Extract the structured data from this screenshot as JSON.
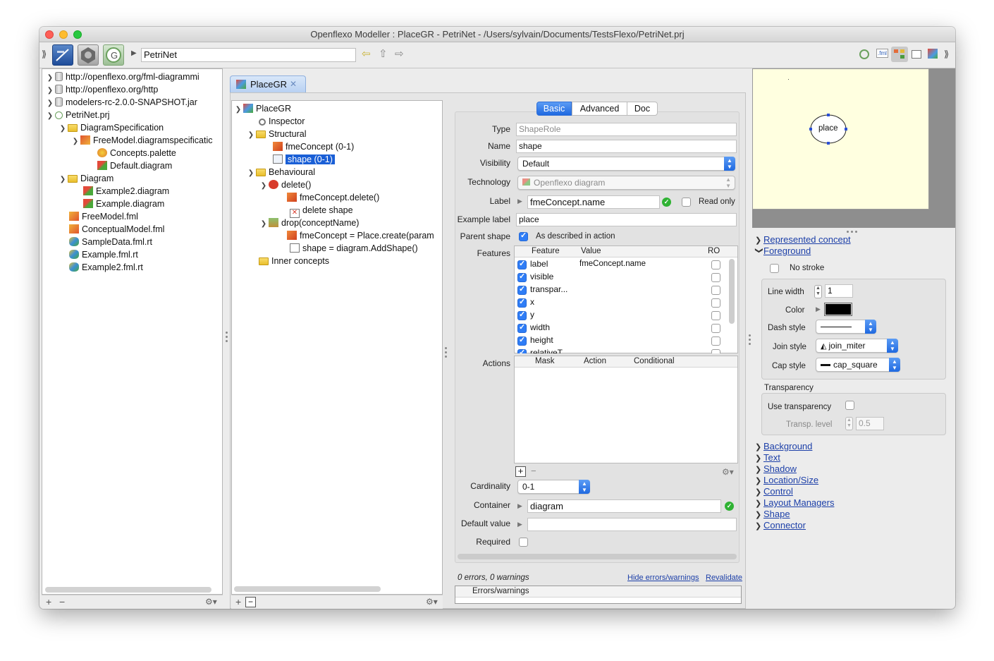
{
  "window": {
    "title": "Openflexo Modeller : PlaceGR - PetriNet - /Users/sylvain/Documents/TestsFlexo/PetriNet.prj"
  },
  "toolbar": {
    "path": "PetriNet"
  },
  "project_tree": [
    {
      "label": "http://openflexo.org/fml-diagrammi"
    },
    {
      "label": "http://openflexo.org/http"
    },
    {
      "label": "modelers-rc-2.0.0-SNAPSHOT.jar"
    },
    {
      "label": "PetriNet.prj"
    },
    {
      "label": "DiagramSpecification"
    },
    {
      "label": "FreeModel.diagramspecificatic"
    },
    {
      "label": "Concepts.palette"
    },
    {
      "label": "Default.diagram"
    },
    {
      "label": "Diagram"
    },
    {
      "label": "Example2.diagram"
    },
    {
      "label": "Example.diagram"
    },
    {
      "label": "FreeModel.fml"
    },
    {
      "label": "ConceptualModel.fml"
    },
    {
      "label": "SampleData.fml.rt"
    },
    {
      "label": "Example.fml.rt"
    },
    {
      "label": "Example2.fml.rt"
    }
  ],
  "editor_tab": {
    "label": "PlaceGR",
    "close": "✕"
  },
  "concept_tree": [
    {
      "label": "PlaceGR"
    },
    {
      "label": "Inspector"
    },
    {
      "label": "Structural"
    },
    {
      "label": "fmeConcept (0-1)"
    },
    {
      "label": "shape (0-1)"
    },
    {
      "label": "Behavioural"
    },
    {
      "label": "delete()"
    },
    {
      "label": "fmeConcept.delete()"
    },
    {
      "label": "delete shape"
    },
    {
      "label": "drop(conceptName)"
    },
    {
      "label": "fmeConcept = Place.create(param"
    },
    {
      "label": "shape = diagram.AddShape()"
    },
    {
      "label": "Inner concepts"
    }
  ],
  "inspector": {
    "tabs": [
      "Basic",
      "Advanced",
      "Doc"
    ],
    "type_label": "Type",
    "type_value": "ShapeRole",
    "name_label": "Name",
    "name_value": "shape",
    "visibility_label": "Visibility",
    "visibility_value": "Default",
    "technology_label": "Technology",
    "technology_value": "Openflexo diagram",
    "label_label": "Label",
    "label_value": "fmeConcept.name",
    "readonly_label": "Read only",
    "example_label_label": "Example label",
    "example_label_value": "place",
    "parent_shape_label": "Parent shape",
    "parent_shape_value": "As described in action",
    "features_label": "Features",
    "features_headers": [
      "Feature",
      "Value",
      "RO"
    ],
    "features": [
      {
        "feature": "label",
        "value": "fmeConcept.name"
      },
      {
        "feature": "visible",
        "value": ""
      },
      {
        "feature": "transpar...",
        "value": ""
      },
      {
        "feature": "x",
        "value": ""
      },
      {
        "feature": "y",
        "value": ""
      },
      {
        "feature": "width",
        "value": ""
      },
      {
        "feature": "height",
        "value": ""
      },
      {
        "feature": "relativeT",
        "value": ""
      }
    ],
    "actions_label": "Actions",
    "actions_headers": [
      "Mask",
      "Action",
      "Conditional"
    ],
    "cardinality_label": "Cardinality",
    "cardinality_value": "0-1",
    "container_label": "Container",
    "container_value": "diagram",
    "default_value_label": "Default value",
    "default_value_value": "",
    "required_label": "Required",
    "status": "0 errors, 0 warnings",
    "hide_link": "Hide errors/warnings",
    "revalidate_link": "Revalidate",
    "errors_header": "Errors/warnings"
  },
  "preview": {
    "shape_label": "place"
  },
  "properties": {
    "represented_concept": "Represented concept",
    "foreground": "Foreground",
    "no_stroke": "No stroke",
    "line_width_label": "Line width",
    "line_width_value": "1",
    "color_label": "Color",
    "color_value": "#000000",
    "dash_style_label": "Dash style",
    "join_style_label": "Join style",
    "join_style_value": "join_miter",
    "cap_style_label": "Cap style",
    "cap_style_value": "cap_square",
    "transparency_header": "Transparency",
    "use_transparency_label": "Use transparency",
    "transp_level_label": "Transp. level",
    "transp_level_value": "0.5",
    "sections": [
      "Background",
      "Text",
      "Shadow",
      "Location/Size",
      "Control",
      "Layout Managers",
      "Shape",
      "Connector"
    ]
  }
}
